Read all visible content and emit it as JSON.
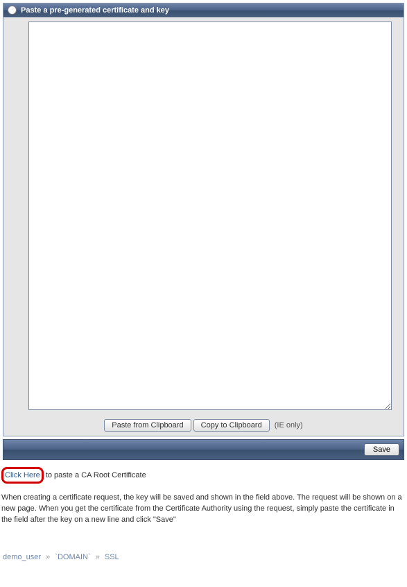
{
  "section": {
    "title": "Paste a pre-generated certificate and key",
    "textarea_value": "",
    "paste_btn": "Paste from Clipboard",
    "copy_btn": "Copy to Clipboard",
    "ie_only": "(IE only)"
  },
  "save_label": "Save",
  "ca_hint": {
    "click_here": "Click Here",
    "rest": " to paste a CA Root Certificate"
  },
  "help": "When creating a certificate request, the key will be saved and shown in the field above. The request will be shown on a new page. When you get the certificate from the Certificate Authority using the request, simply paste the certificate in the field after the key on a new line and click \"Save\"",
  "breadcrumb": {
    "user": "demo_user",
    "domain": "`DOMAIN`",
    "page": "SSL",
    "sep": "»"
  }
}
